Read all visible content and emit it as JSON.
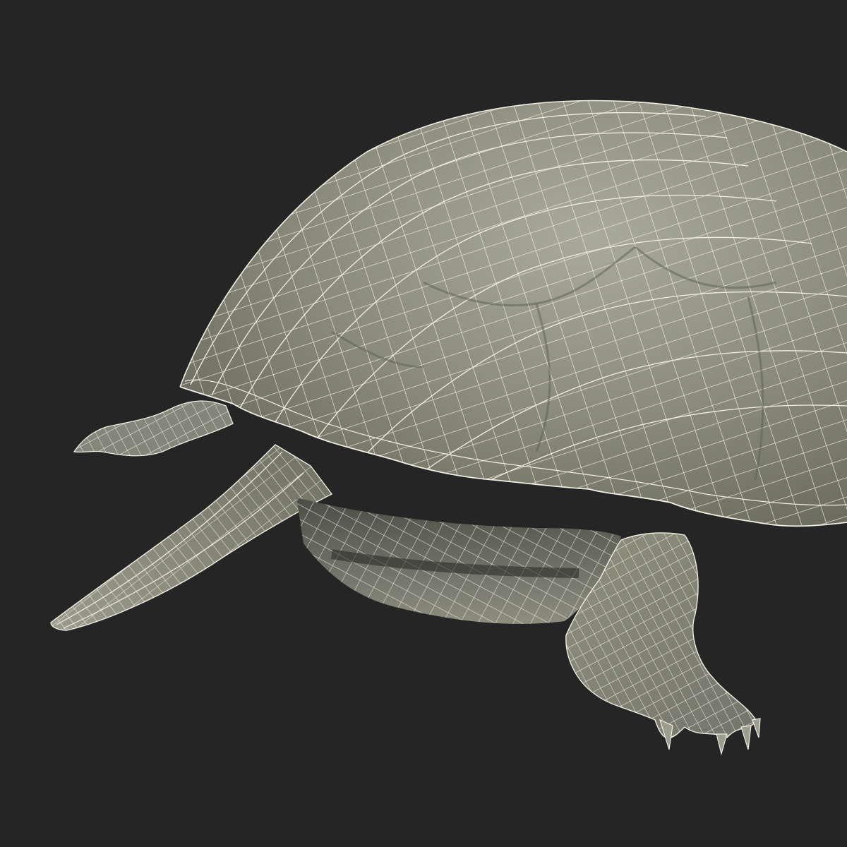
{
  "scene": {
    "subject": "turtle-wireframe-render",
    "colors": {
      "background": "#252525",
      "surface": "#8a8b7c",
      "surface_dark": "#5f6055",
      "surface_light": "#a5a697",
      "wire": "#f1efe2",
      "shadow": "#3f403a"
    }
  }
}
